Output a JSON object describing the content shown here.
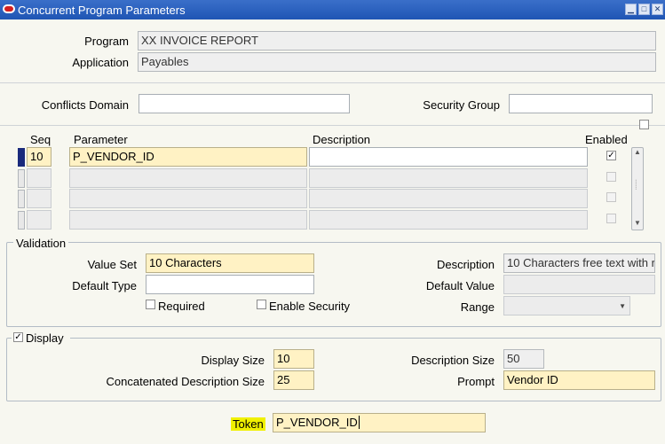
{
  "window": {
    "title": "Concurrent Program Parameters"
  },
  "header": {
    "program_label": "Program",
    "program_value": "XX INVOICE REPORT",
    "application_label": "Application",
    "application_value": "Payables"
  },
  "conflicts": {
    "domain_label": "Conflicts Domain",
    "domain_value": "",
    "security_group_label": "Security Group",
    "security_group_value": ""
  },
  "table": {
    "columns": {
      "seq": "Seq",
      "parameter": "Parameter",
      "description": "Description",
      "enabled": "Enabled"
    },
    "rows": [
      {
        "seq": "10",
        "parameter": "P_VENDOR_ID",
        "description": "",
        "enabled": true
      },
      {
        "seq": "",
        "parameter": "",
        "description": "",
        "enabled": false
      },
      {
        "seq": "",
        "parameter": "",
        "description": "",
        "enabled": false
      },
      {
        "seq": "",
        "parameter": "",
        "description": "",
        "enabled": false
      }
    ]
  },
  "validation": {
    "title": "Validation",
    "value_set_label": "Value Set",
    "value_set_value": "10 Characters",
    "default_type_label": "Default Type",
    "default_type_value": "",
    "required_label": "Required",
    "required_checked": false,
    "enable_security_label": "Enable Security",
    "enable_security_checked": false,
    "description_label": "Description",
    "description_value": "10 Characters free text with r",
    "default_value_label": "Default Value",
    "default_value_value": "",
    "range_label": "Range",
    "range_value": ""
  },
  "display": {
    "title": "Display",
    "checked": true,
    "display_size_label": "Display Size",
    "display_size_value": "10",
    "concat_desc_size_label": "Concatenated Description Size",
    "concat_desc_size_value": "25",
    "description_size_label": "Description Size",
    "description_size_value": "50",
    "prompt_label": "Prompt",
    "prompt_value": "Vendor ID"
  },
  "token": {
    "label": "Token",
    "value": "P_VENDOR_ID",
    "highlight_color": "#f0f000"
  },
  "colors": {
    "title_bar": "#1f55b4",
    "required_field": "#fff2c4",
    "current_row": "#1a2a7c"
  }
}
